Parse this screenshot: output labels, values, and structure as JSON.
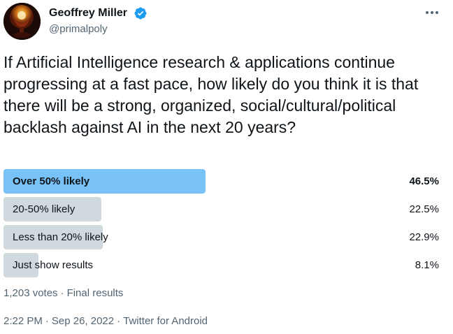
{
  "author": {
    "name": "Geoffrey Miller",
    "handle": "@primalpoly",
    "verified": true
  },
  "tweet": {
    "text": "If Artificial Intelligence research & applications continue progressing at a fast pace, how likely do you think it is that there will be a strong, organized, social/cultural/political backlash against AI in the next 20 years?"
  },
  "poll": {
    "options": [
      {
        "label": "Over 50% likely",
        "percent": "46.5%",
        "value": 46.5,
        "winner": true
      },
      {
        "label": "20-50% likely",
        "percent": "22.5%",
        "value": 22.5,
        "winner": false
      },
      {
        "label": "Less than 20% likely",
        "percent": "22.9%",
        "value": 22.9,
        "winner": false
      },
      {
        "label": "Just show results",
        "percent": "8.1%",
        "value": 8.1,
        "winner": false
      }
    ],
    "votes": "1,203 votes",
    "sep": "·",
    "status": "Final results"
  },
  "meta": {
    "time": "2:22 PM",
    "sep1": "·",
    "date": "Sep 26, 2022",
    "sep2": "·",
    "source": "Twitter for Android"
  },
  "colors": {
    "winner_bar": "#78c2f7",
    "bar": "#cfd9de",
    "verified": "#1d9bf0",
    "secondary_text": "#536471"
  },
  "icons": {
    "more": "more-horizontal-icon",
    "verified": "verified-badge-icon"
  }
}
